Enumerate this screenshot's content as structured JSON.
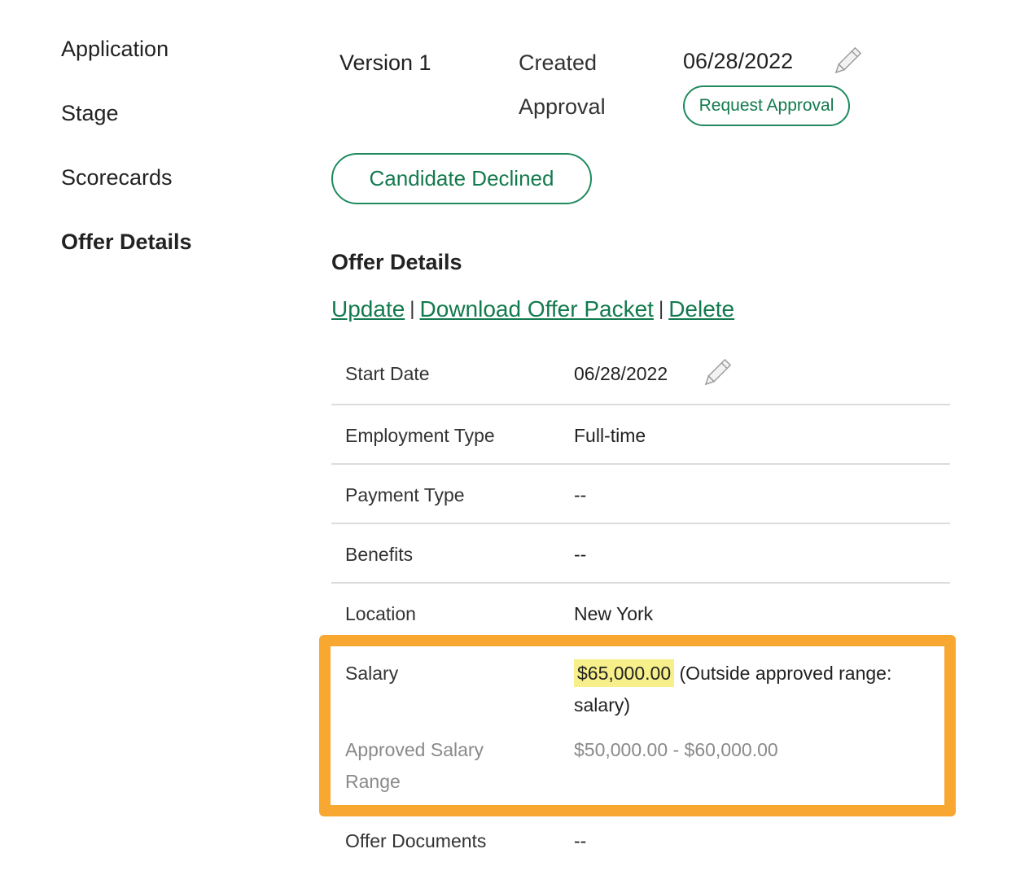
{
  "sidebar": {
    "items": [
      {
        "label": "Application"
      },
      {
        "label": "Stage"
      },
      {
        "label": "Scorecards"
      },
      {
        "label": "Offer Details"
      }
    ]
  },
  "version": {
    "title": "Version 1",
    "created_label": "Created",
    "created_date": "06/28/2022",
    "approval_label": "Approval",
    "request_approval_label": "Request Approval"
  },
  "status_button_label": "Candidate Declined",
  "offer_details": {
    "heading": "Offer Details",
    "actions": {
      "update": "Update",
      "download": "Download Offer Packet",
      "delete": "Delete",
      "separator": "|"
    },
    "rows": {
      "start_date": {
        "label": "Start Date",
        "value": "06/28/2022"
      },
      "employment_type": {
        "label": "Employment Type",
        "value": "Full-time"
      },
      "payment_type": {
        "label": "Payment Type",
        "value": "--"
      },
      "benefits": {
        "label": "Benefits",
        "value": "--"
      },
      "location": {
        "label": "Location",
        "value": "New York"
      },
      "salary": {
        "label": "Salary",
        "amount": "$65,000.00",
        "note_line1": "(Outside approved range:",
        "note_line2": "salary)"
      },
      "approved_range": {
        "label_line1": "Approved Salary",
        "label_line2": "Range",
        "value": "$50,000.00 - $60,000.00"
      },
      "offer_documents": {
        "label": "Offer Documents",
        "value": "--"
      }
    }
  },
  "colors": {
    "accent_green": "#137a4f",
    "highlight_orange": "#f8a731",
    "salary_highlight": "#f7f08a"
  },
  "icons": {
    "edit": "pencil-icon"
  }
}
